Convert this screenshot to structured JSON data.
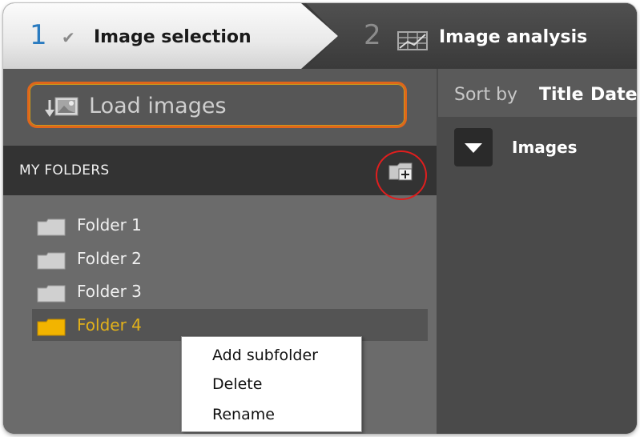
{
  "wizard": {
    "steps": [
      {
        "number": "1",
        "label": "Image selection",
        "status_icon": "checkmark-icon",
        "active": true
      },
      {
        "number": "2",
        "label": "Image analysis",
        "status_icon": "grid-chart-icon",
        "active": false
      }
    ]
  },
  "load": {
    "label": "Load images",
    "icon": "load-images-icon",
    "highlight_color": "#e0661a"
  },
  "folders": {
    "header": "MY FOLDERS",
    "add_icon": "add-folder-icon",
    "add_highlight_color": "#e01e1e",
    "items": [
      {
        "label": "Folder 1",
        "selected": false
      },
      {
        "label": "Folder 2",
        "selected": false
      },
      {
        "label": "Folder 3",
        "selected": false
      },
      {
        "label": "Folder 4",
        "selected": true
      }
    ],
    "selected_color": "#e3b21a"
  },
  "context_menu": {
    "items": [
      {
        "label": "Add subfolder"
      },
      {
        "label": "Delete"
      },
      {
        "label": "Rename"
      }
    ]
  },
  "sort": {
    "label": "Sort by",
    "options": [
      "Title",
      "Date"
    ]
  },
  "images": {
    "toggle_icon": "triangle-down-icon",
    "label": "Images"
  },
  "accent_colors": {
    "step_number": "#2a7bc0"
  }
}
